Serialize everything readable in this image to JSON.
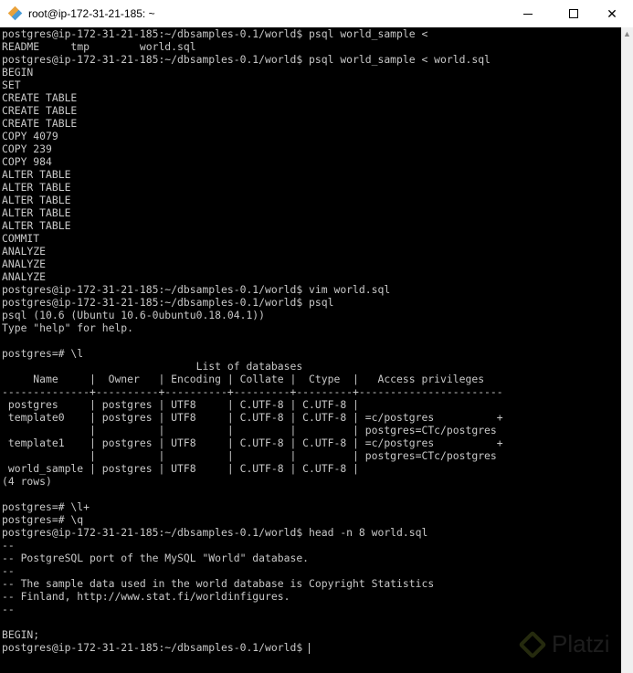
{
  "window": {
    "title": "root@ip-172-31-21-185: ~",
    "icon": "git-bash-diamond-icon"
  },
  "terminal": {
    "lines": [
      "postgres@ip-172-31-21-185:~/dbsamples-0.1/world$ psql world_sample <",
      "README     tmp        world.sql",
      "postgres@ip-172-31-21-185:~/dbsamples-0.1/world$ psql world_sample < world.sql",
      "BEGIN",
      "SET",
      "CREATE TABLE",
      "CREATE TABLE",
      "CREATE TABLE",
      "COPY 4079",
      "COPY 239",
      "COPY 984",
      "ALTER TABLE",
      "ALTER TABLE",
      "ALTER TABLE",
      "ALTER TABLE",
      "ALTER TABLE",
      "COMMIT",
      "ANALYZE",
      "ANALYZE",
      "ANALYZE",
      "postgres@ip-172-31-21-185:~/dbsamples-0.1/world$ vim world.sql",
      "postgres@ip-172-31-21-185:~/dbsamples-0.1/world$ psql",
      "psql (10.6 (Ubuntu 10.6-0ubuntu0.18.04.1))",
      "Type \"help\" for help.",
      "",
      "postgres=# \\l",
      "                               List of databases",
      "     Name     |  Owner   | Encoding | Collate |  Ctype  |   Access privileges",
      "--------------+----------+----------+---------+---------+-----------------------",
      " postgres     | postgres | UTF8     | C.UTF-8 | C.UTF-8 |",
      " template0    | postgres | UTF8     | C.UTF-8 | C.UTF-8 | =c/postgres          +",
      "              |          |          |         |         | postgres=CTc/postgres",
      " template1    | postgres | UTF8     | C.UTF-8 | C.UTF-8 | =c/postgres          +",
      "              |          |          |         |         | postgres=CTc/postgres",
      " world_sample | postgres | UTF8     | C.UTF-8 | C.UTF-8 |",
      "(4 rows)",
      "",
      "postgres=# \\l+",
      "postgres=# \\q",
      "postgres@ip-172-31-21-185:~/dbsamples-0.1/world$ head -n 8 world.sql",
      "--",
      "-- PostgreSQL port of the MySQL \"World\" database.",
      "--",
      "-- The sample data used in the world database is Copyright Statistics",
      "-- Finland, http://www.stat.fi/worldinfigures.",
      "--",
      "",
      "BEGIN;"
    ],
    "prompt": "postgres@ip-172-31-21-185:~/dbsamples-0.1/world$ "
  },
  "watermark": "Platzi"
}
